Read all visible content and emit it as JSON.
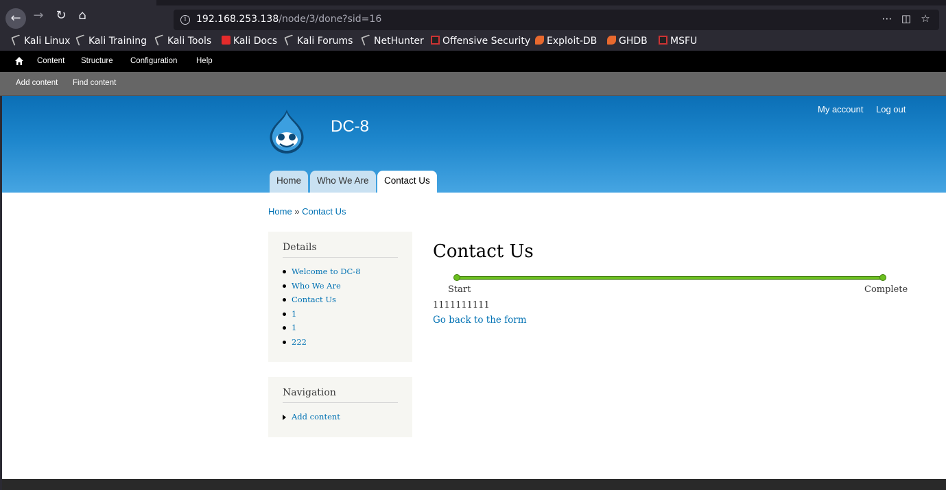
{
  "browser": {
    "url_host": "192.168.253.138",
    "url_path": "/node/3/done?sid=16",
    "bookmarks": [
      "Kali Linux",
      "Kali Training",
      "Kali Tools",
      "Kali Docs",
      "Kali Forums",
      "NetHunter",
      "Offensive Security",
      "Exploit-DB",
      "GHDB",
      "MSFU"
    ]
  },
  "admin_toolbar": {
    "items": [
      "Content",
      "Structure",
      "Configuration",
      "Help"
    ],
    "shortcuts": [
      "Add content",
      "Find content"
    ]
  },
  "header": {
    "site_name": "DC-8",
    "user_links": [
      "My account",
      "Log out"
    ],
    "tabs": [
      "Home",
      "Who We Are",
      "Contact Us"
    ],
    "active_tab": "Contact Us"
  },
  "breadcrumb": {
    "home": "Home",
    "separator": "»",
    "current": "Contact Us"
  },
  "sidebar": {
    "details": {
      "title": "Details",
      "items": [
        "Welcome to DC-8",
        "Who We Are",
        "Contact Us",
        "1",
        "1",
        "222"
      ]
    },
    "navigation": {
      "title": "Navigation",
      "items": [
        "Add content"
      ]
    }
  },
  "main": {
    "title": "Contact Us",
    "progress": {
      "start_label": "Start",
      "end_label": "Complete",
      "value": 1.0
    },
    "submission_text": "1111111111",
    "back_link": "Go back to the form"
  },
  "colors": {
    "link": "#0071b3",
    "progress": "#6bbf1f",
    "header_top": "#0b6fb6",
    "header_bottom": "#46a5e2"
  }
}
